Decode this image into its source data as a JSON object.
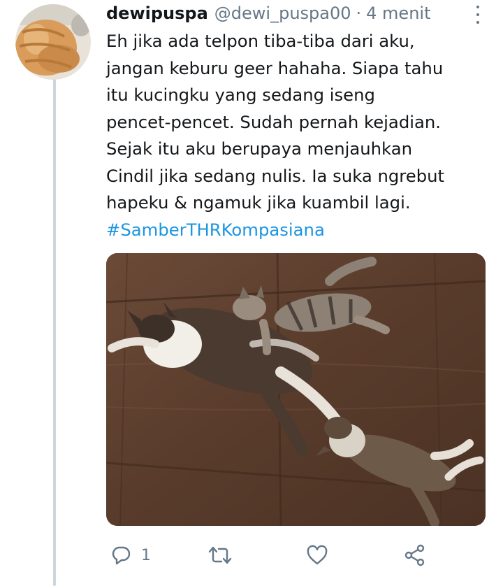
{
  "tweet": {
    "display_name": "dewipuspa",
    "handle": "@dewi_puspa00",
    "separator": "·",
    "time": "4 menit",
    "text_lines": [
      "Eh jika ada telpon tiba-tiba dari aku,",
      "jangan keburu geer hahaha. Siapa tahu",
      "itu kucingku yang sedang iseng",
      "pencet-pencet. Sudah pernah kejadian.",
      "Sejak itu aku berupaya menjauhkan",
      "Cindil jika sedang nulis. Ia suka ngrebut",
      "hapeku & ngamuk jika kuambil lagi."
    ],
    "hashtag": "#SamberTHRKompasiana"
  },
  "actions": {
    "reply": {
      "icon": "reply-icon",
      "count": "1"
    },
    "retweet": {
      "icon": "retweet-icon"
    },
    "like": {
      "icon": "heart-icon"
    },
    "share": {
      "icon": "share-icon"
    }
  },
  "colors": {
    "text": "#14171a",
    "secondary": "#657786",
    "link": "#1b95e0",
    "thread_line": "#cdd6dd"
  }
}
